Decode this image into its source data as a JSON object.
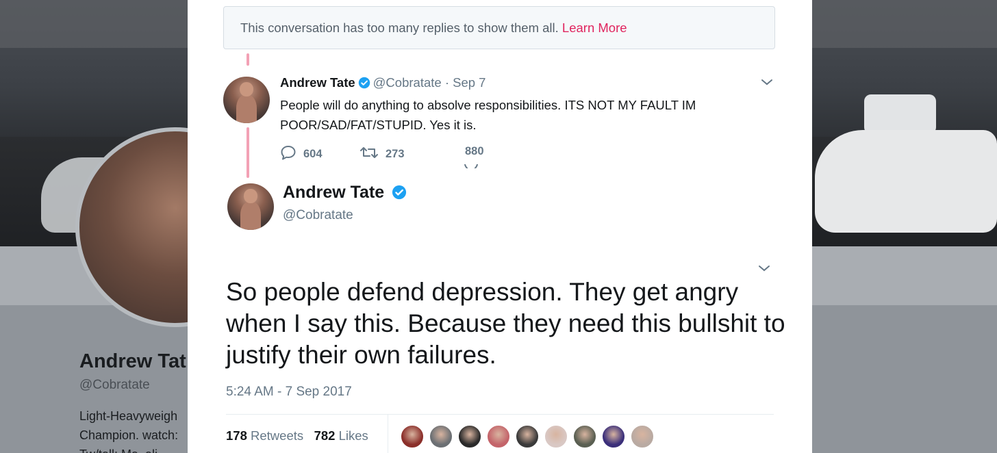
{
  "background_profile": {
    "name": "Andrew Tat",
    "handle": "@Cobratate",
    "bio_lines": [
      "Light-Heavyweigh",
      "Champion. watch:",
      "Tw/tall: Ma..ali"
    ]
  },
  "notice": {
    "text": "This conversation has too many replies to show them all.",
    "link": "Learn More"
  },
  "parent_tweet": {
    "name": "Andrew Tate",
    "handle": "@Cobratate",
    "date": "· Sep 7",
    "text": "People will do anything to absolve responsibilities. ITS NOT MY FAULT IM POOR/SAD/FAT/STUPID. Yes it is.",
    "replies": "604",
    "retweets": "273",
    "likes": "880"
  },
  "main_tweet": {
    "name": "Andrew Tate",
    "handle": "@Cobratate",
    "text": "So people defend depression. They get angry when I say this. Because they need this bullshit to justify their own failures.",
    "timestamp": "5:24 AM - 7 Sep 2017",
    "retweets_count": "178",
    "retweets_label": "Retweets",
    "likes_count": "782",
    "likes_label": "Likes"
  },
  "colors": {
    "link": "#e0245e",
    "verified": "#1da1f2",
    "thread_line": "#f3a1b5",
    "muted": "#657786"
  },
  "liker_avatar_colors": [
    "#8b2f2a",
    "#6b6f73",
    "#2a2a2a",
    "#c4646a",
    "#3a3a3a",
    "#d9c8c4",
    "#5a5f52",
    "#3b2f7a",
    "#b9aaa2"
  ]
}
